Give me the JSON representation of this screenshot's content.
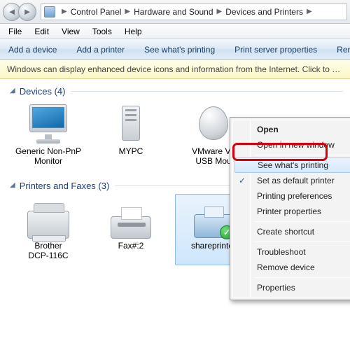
{
  "breadcrumb": {
    "segments": [
      "Control Panel",
      "Hardware and Sound",
      "Devices and Printers"
    ]
  },
  "menubar": [
    "File",
    "Edit",
    "View",
    "Tools",
    "Help"
  ],
  "commandbar": [
    "Add a device",
    "Add a printer",
    "See what's printing",
    "Print server properties",
    "Remov"
  ],
  "infobar_text": "Windows can display enhanced device icons and information from the Internet. Click to change...",
  "groups": {
    "devices": {
      "title": "Devices",
      "count": 4,
      "items": [
        {
          "label1": "Generic Non-PnP",
          "label2": "Monitor",
          "icon": "monitor"
        },
        {
          "label1": "MYPC",
          "label2": "",
          "icon": "pc"
        },
        {
          "label1": "VMware Vir",
          "label2": "USB Mou",
          "icon": "mouse"
        }
      ]
    },
    "printers": {
      "title": "Printers and Faxes",
      "count": 3,
      "items": [
        {
          "label1": "Brother",
          "label2": "DCP-116C",
          "icon": "fax"
        },
        {
          "label1": "Fax#:2",
          "label2": "",
          "icon": "printer"
        },
        {
          "label1": "shareprinter",
          "label2": "",
          "icon": "netprinter",
          "selected": true,
          "badged": true
        }
      ]
    }
  },
  "context_menu": {
    "open": "Open",
    "open_new": "Open in new window",
    "see_printing": "See what's printing",
    "set_default": "Set as default printer",
    "prefs": "Printing preferences",
    "props": "Printer properties",
    "shortcut": "Create shortcut",
    "troubleshoot": "Troubleshoot",
    "remove": "Remove device",
    "properties": "Properties"
  }
}
